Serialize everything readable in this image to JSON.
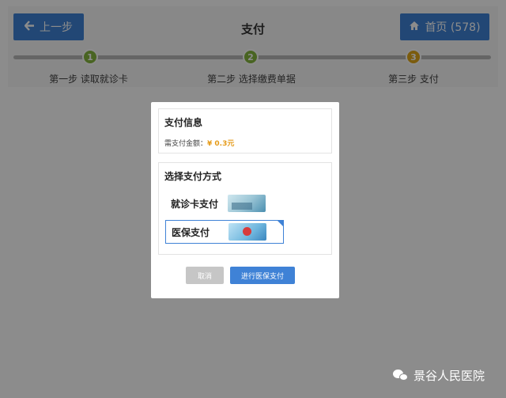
{
  "header": {
    "back_label": "上一步",
    "title": "支付",
    "home_label": "首页 (578)"
  },
  "steps": [
    {
      "number": "1",
      "label": "第一步 读取就诊卡",
      "color": "#86b73f"
    },
    {
      "number": "2",
      "label": "第二步 选择缴费单据",
      "color": "#86b73f"
    },
    {
      "number": "3",
      "label": "第三步 支付",
      "color": "#e1a81b"
    }
  ],
  "modal": {
    "info_title": "支付信息",
    "amount_label": "需支付金额：",
    "amount_value": "¥ 0.3元",
    "method_title": "选择支付方式",
    "options": [
      {
        "label": "就诊卡支付",
        "icon": "medical-card-icon",
        "selected": false
      },
      {
        "label": "医保支付",
        "icon": "insurance-card-icon",
        "selected": true
      }
    ],
    "cancel_label": "取消",
    "confirm_label": "进行医保支付"
  },
  "watermark": {
    "text": "景谷人民医院",
    "icon": "wechat-icon"
  },
  "colors": {
    "accent": "#3f82d6",
    "amount": "#e59b1a"
  }
}
